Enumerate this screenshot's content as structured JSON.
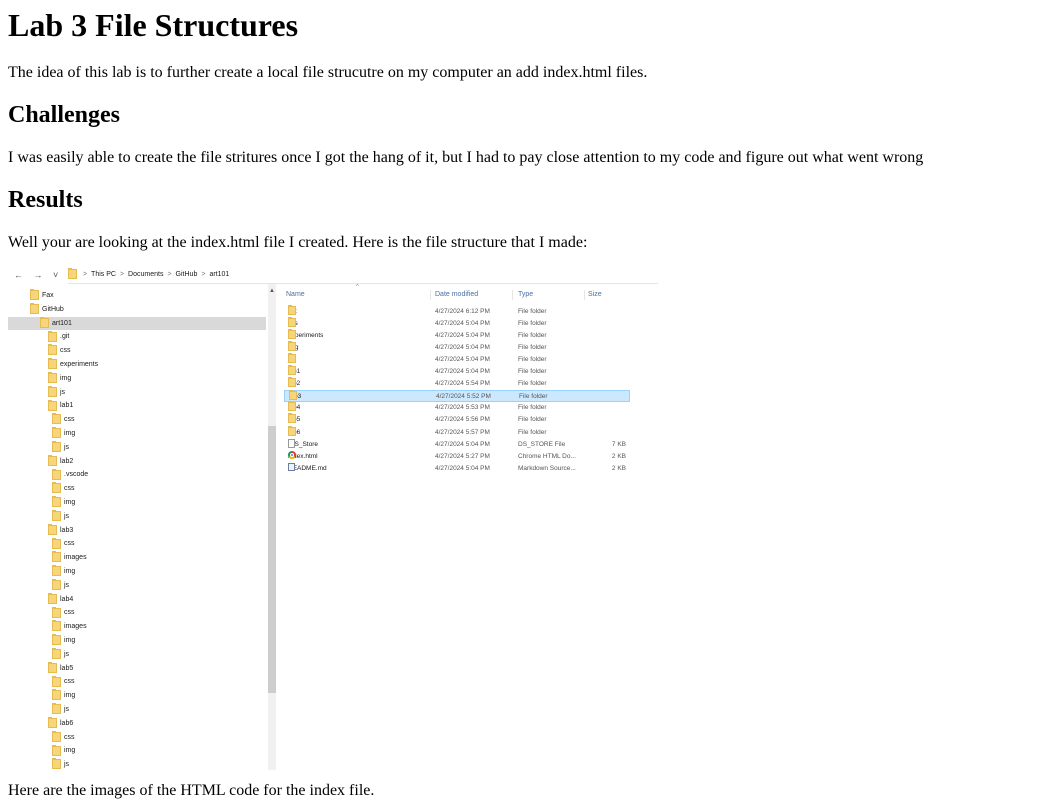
{
  "page": {
    "title": "Lab 3 File Structures",
    "intro": "The idea of this lab is to further create a local file strucutre on my computer an add index.html files.",
    "challenges_heading": "Challenges",
    "challenges_text": "I was easily able to create the file stritures once I got the hang of it, but I had to pay close attention to my code and figure out what went wrong",
    "results_heading": "Results",
    "results_text": "Well your are looking at the index.html file I created. Here is the file structure that I made:",
    "cut_text": "Here are the images of the HTML code for the index file."
  },
  "explorer": {
    "breadcrumb": [
      "This PC",
      "Documents",
      "GitHub",
      "art101"
    ],
    "breadcrumb_sep": ">",
    "nav_icons": [
      "back-arrow-icon",
      "forward-arrow-icon",
      "recent-dropdown-icon",
      "up-arrow-icon"
    ],
    "nav_glyphs": "← → ˅ ↑",
    "columns": {
      "name": "Name",
      "date": "Date modified",
      "type": "Type",
      "size": "Size"
    },
    "tree": [
      {
        "label": "Fax",
        "level": 0
      },
      {
        "label": "GitHub",
        "level": 0
      },
      {
        "label": "art101",
        "level": 1,
        "selected": true
      },
      {
        "label": ".git",
        "level": 2
      },
      {
        "label": "css",
        "level": 2
      },
      {
        "label": "experiments",
        "level": 2
      },
      {
        "label": "img",
        "level": 2
      },
      {
        "label": "js",
        "level": 2
      },
      {
        "label": "lab1",
        "level": 2
      },
      {
        "label": "css",
        "level": 3
      },
      {
        "label": "img",
        "level": 3
      },
      {
        "label": "js",
        "level": 3
      },
      {
        "label": "lab2",
        "level": 2
      },
      {
        "label": ".vscode",
        "level": 3
      },
      {
        "label": "css",
        "level": 3
      },
      {
        "label": "img",
        "level": 3
      },
      {
        "label": "js",
        "level": 3
      },
      {
        "label": "lab3",
        "level": 2
      },
      {
        "label": "css",
        "level": 3
      },
      {
        "label": "images",
        "level": 3
      },
      {
        "label": "img",
        "level": 3
      },
      {
        "label": "js",
        "level": 3
      },
      {
        "label": "lab4",
        "level": 2
      },
      {
        "label": "css",
        "level": 3
      },
      {
        "label": "images",
        "level": 3
      },
      {
        "label": "img",
        "level": 3
      },
      {
        "label": "js",
        "level": 3
      },
      {
        "label": "lab5",
        "level": 2
      },
      {
        "label": "css",
        "level": 3
      },
      {
        "label": "img",
        "level": 3
      },
      {
        "label": "js",
        "level": 3
      },
      {
        "label": "lab6",
        "level": 2
      },
      {
        "label": "css",
        "level": 3
      },
      {
        "label": "img",
        "level": 3
      },
      {
        "label": "js",
        "level": 3
      }
    ],
    "files": [
      {
        "name": ".git",
        "date": "4/27/2024 6:12 PM",
        "type": "File folder",
        "size": "",
        "icon": "folder"
      },
      {
        "name": "css",
        "date": "4/27/2024 5:04 PM",
        "type": "File folder",
        "size": "",
        "icon": "folder"
      },
      {
        "name": "experiments",
        "date": "4/27/2024 5:04 PM",
        "type": "File folder",
        "size": "",
        "icon": "folder"
      },
      {
        "name": "img",
        "date": "4/27/2024 5:04 PM",
        "type": "File folder",
        "size": "",
        "icon": "folder"
      },
      {
        "name": "js",
        "date": "4/27/2024 5:04 PM",
        "type": "File folder",
        "size": "",
        "icon": "folder"
      },
      {
        "name": "lab1",
        "date": "4/27/2024 5:04 PM",
        "type": "File folder",
        "size": "",
        "icon": "folder"
      },
      {
        "name": "lab2",
        "date": "4/27/2024 5:54 PM",
        "type": "File folder",
        "size": "",
        "icon": "folder"
      },
      {
        "name": "lab3",
        "date": "4/27/2024 5:52 PM",
        "type": "File folder",
        "size": "",
        "icon": "folder",
        "selected": true
      },
      {
        "name": "lab4",
        "date": "4/27/2024 5:53 PM",
        "type": "File folder",
        "size": "",
        "icon": "folder"
      },
      {
        "name": "lab5",
        "date": "4/27/2024 5:56 PM",
        "type": "File folder",
        "size": "",
        "icon": "folder"
      },
      {
        "name": "lab6",
        "date": "4/27/2024 5:57 PM",
        "type": "File folder",
        "size": "",
        "icon": "folder"
      },
      {
        "name": ".DS_Store",
        "date": "4/27/2024 5:04 PM",
        "type": "DS_STORE File",
        "size": "7 KB",
        "icon": "file"
      },
      {
        "name": "index.html",
        "date": "4/27/2024 5:27 PM",
        "type": "Chrome HTML Do...",
        "size": "2 KB",
        "icon": "chrome"
      },
      {
        "name": "README.md",
        "date": "4/27/2024 5:04 PM",
        "type": "Markdown Source...",
        "size": "2 KB",
        "icon": "markdown"
      }
    ]
  }
}
